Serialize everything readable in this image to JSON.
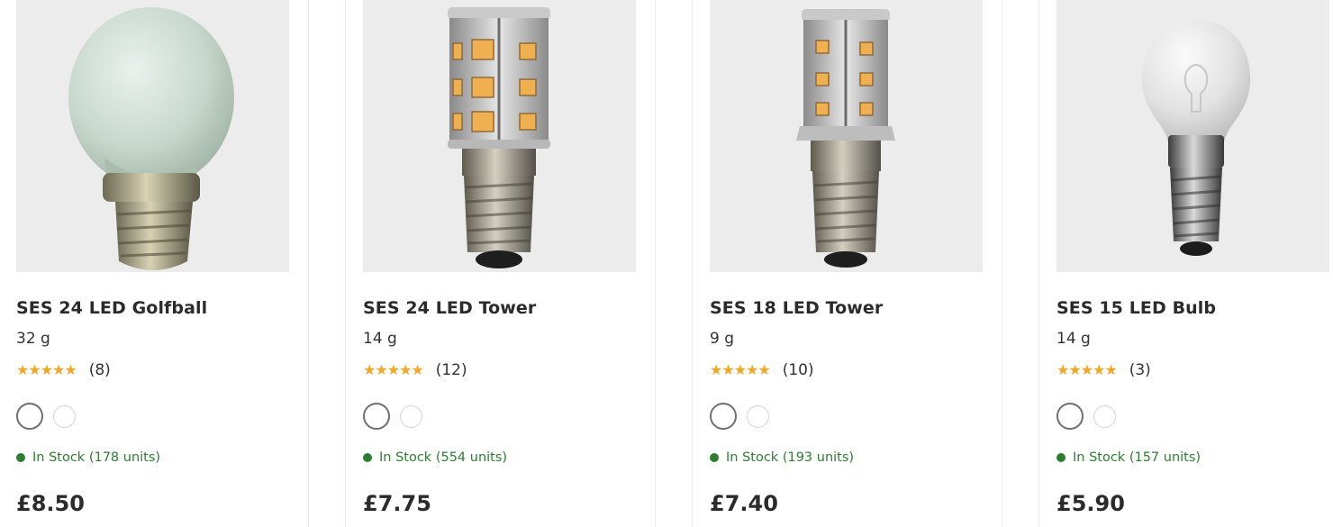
{
  "products": [
    {
      "name": "SES 24 LED Golfball",
      "weight": "32 g",
      "stars": "★★★★★",
      "reviews": "(8)",
      "stock": "In Stock (178 units)",
      "price": "£8.50",
      "image_icon": "golfball-bulb-icon"
    },
    {
      "name": "SES 24 LED Tower",
      "weight": "14 g",
      "stars": "★★★★★",
      "reviews": "(12)",
      "stock": "In Stock (554 units)",
      "price": "£7.75",
      "image_icon": "led-tower-bulb-icon"
    },
    {
      "name": "SES 18 LED Tower",
      "weight": "9 g",
      "stars": "★★★★★",
      "reviews": "(10)",
      "stock": "In Stock (193 units)",
      "price": "£7.40",
      "image_icon": "led-tower-bulb-icon"
    },
    {
      "name": "SES 15 LED Bulb",
      "weight": "14 g",
      "stars": "★★★★★",
      "reviews": "(3)",
      "stock": "In Stock (157 units)",
      "price": "£5.90",
      "image_icon": "pygmy-bulb-icon"
    }
  ],
  "colors": {
    "star": "#f5a623",
    "in_stock": "#2e7d32",
    "image_bg": "#ececec"
  }
}
